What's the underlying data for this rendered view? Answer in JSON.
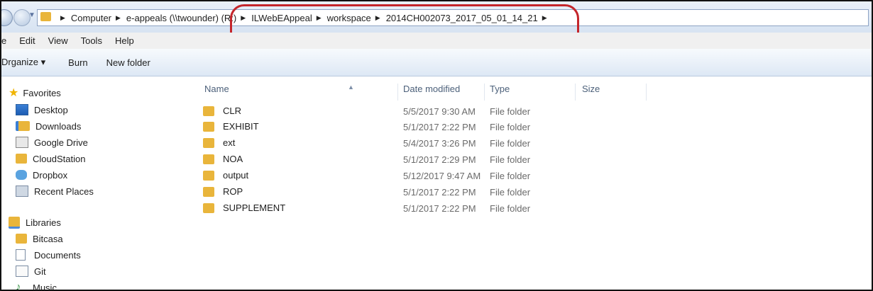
{
  "address": {
    "crumbs": [
      "Computer",
      "e-appeals (\\\\twounder) (R:)",
      "ILWebEAppeal",
      "workspace",
      "2014CH002073_2017_05_01_14_21"
    ]
  },
  "menu": [
    "e",
    "Edit",
    "View",
    "Tools",
    "Help"
  ],
  "toolbar": {
    "organize": "Drganize ▾",
    "burn": "Burn",
    "new_folder": "New folder"
  },
  "nav": {
    "favorites_label": "Favorites",
    "favorites": [
      "Desktop",
      "Downloads",
      "Google Drive",
      "CloudStation",
      "Dropbox",
      "Recent Places"
    ],
    "libraries_label": "Libraries",
    "libraries": [
      "Bitcasa",
      "Documents",
      "Git",
      "Music"
    ]
  },
  "columns": {
    "name": "Name",
    "date": "Date modified",
    "type": "Type",
    "size": "Size"
  },
  "files": [
    {
      "name": "CLR",
      "date": "5/5/2017 9:30 AM",
      "type": "File folder"
    },
    {
      "name": "EXHIBIT",
      "date": "5/1/2017 2:22 PM",
      "type": "File folder"
    },
    {
      "name": "ext",
      "date": "5/4/2017 3:26 PM",
      "type": "File folder"
    },
    {
      "name": "NOA",
      "date": "5/1/2017 2:29 PM",
      "type": "File folder"
    },
    {
      "name": "output",
      "date": "5/12/2017 9:47 AM",
      "type": "File folder"
    },
    {
      "name": "ROP",
      "date": "5/1/2017 2:22 PM",
      "type": "File folder"
    },
    {
      "name": "SUPPLEMENT",
      "date": "5/1/2017 2:22 PM",
      "type": "File folder"
    }
  ]
}
